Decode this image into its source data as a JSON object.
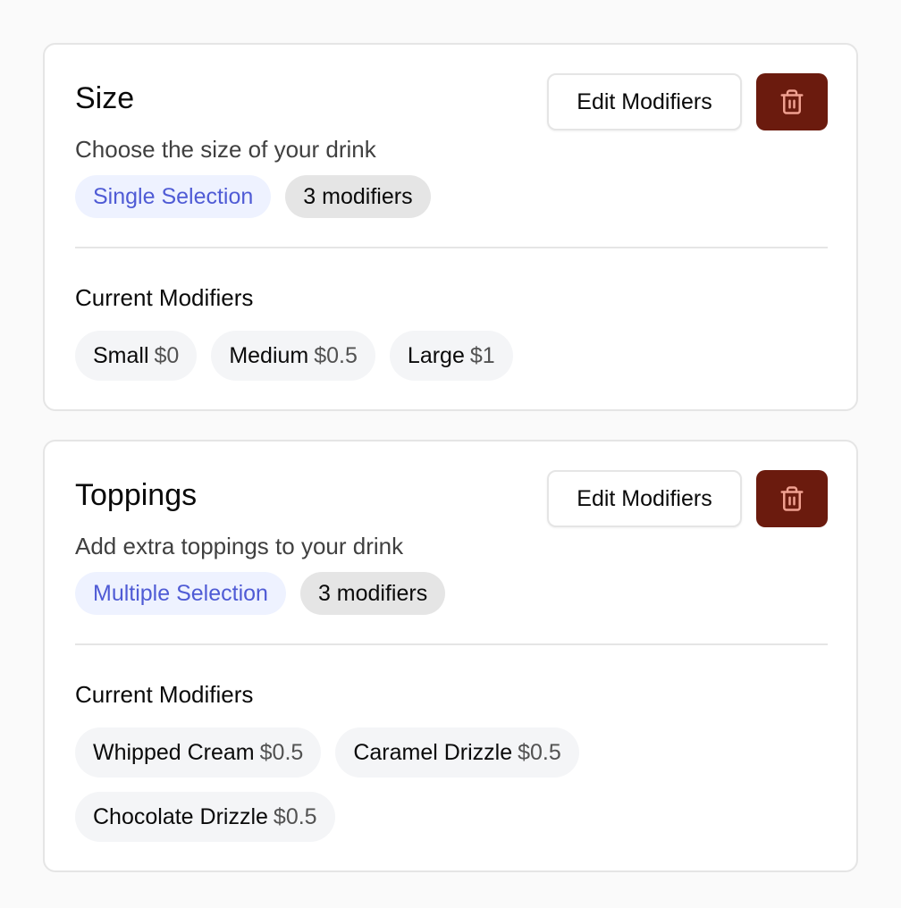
{
  "colors": {
    "page_background": "#fafafa",
    "card_background": "#ffffff",
    "delete_button": "#6b1b0e",
    "delete_icon": "#f0a090",
    "type_badge_bg": "#eef2ff",
    "type_badge_text": "#4f5bd5",
    "count_badge_bg": "#e5e5e5",
    "chip_bg": "#f4f5f7"
  },
  "section_label": "Current Modifiers",
  "edit_label": "Edit Modifiers",
  "delete_icon_name": "trash-icon",
  "groups": [
    {
      "name": "Size",
      "description": "Choose the size of your drink",
      "selection_type": "Single Selection",
      "modifier_count": "3 modifiers",
      "modifiers": [
        {
          "name": "Small",
          "price": "$0"
        },
        {
          "name": "Medium",
          "price": "$0.5"
        },
        {
          "name": "Large",
          "price": "$1"
        }
      ]
    },
    {
      "name": "Toppings",
      "description": "Add extra toppings to your drink",
      "selection_type": "Multiple Selection",
      "modifier_count": "3 modifiers",
      "modifiers": [
        {
          "name": "Whipped Cream",
          "price": "$0.5"
        },
        {
          "name": "Caramel Drizzle",
          "price": "$0.5"
        },
        {
          "name": "Chocolate Drizzle",
          "price": "$0.5"
        }
      ]
    }
  ]
}
